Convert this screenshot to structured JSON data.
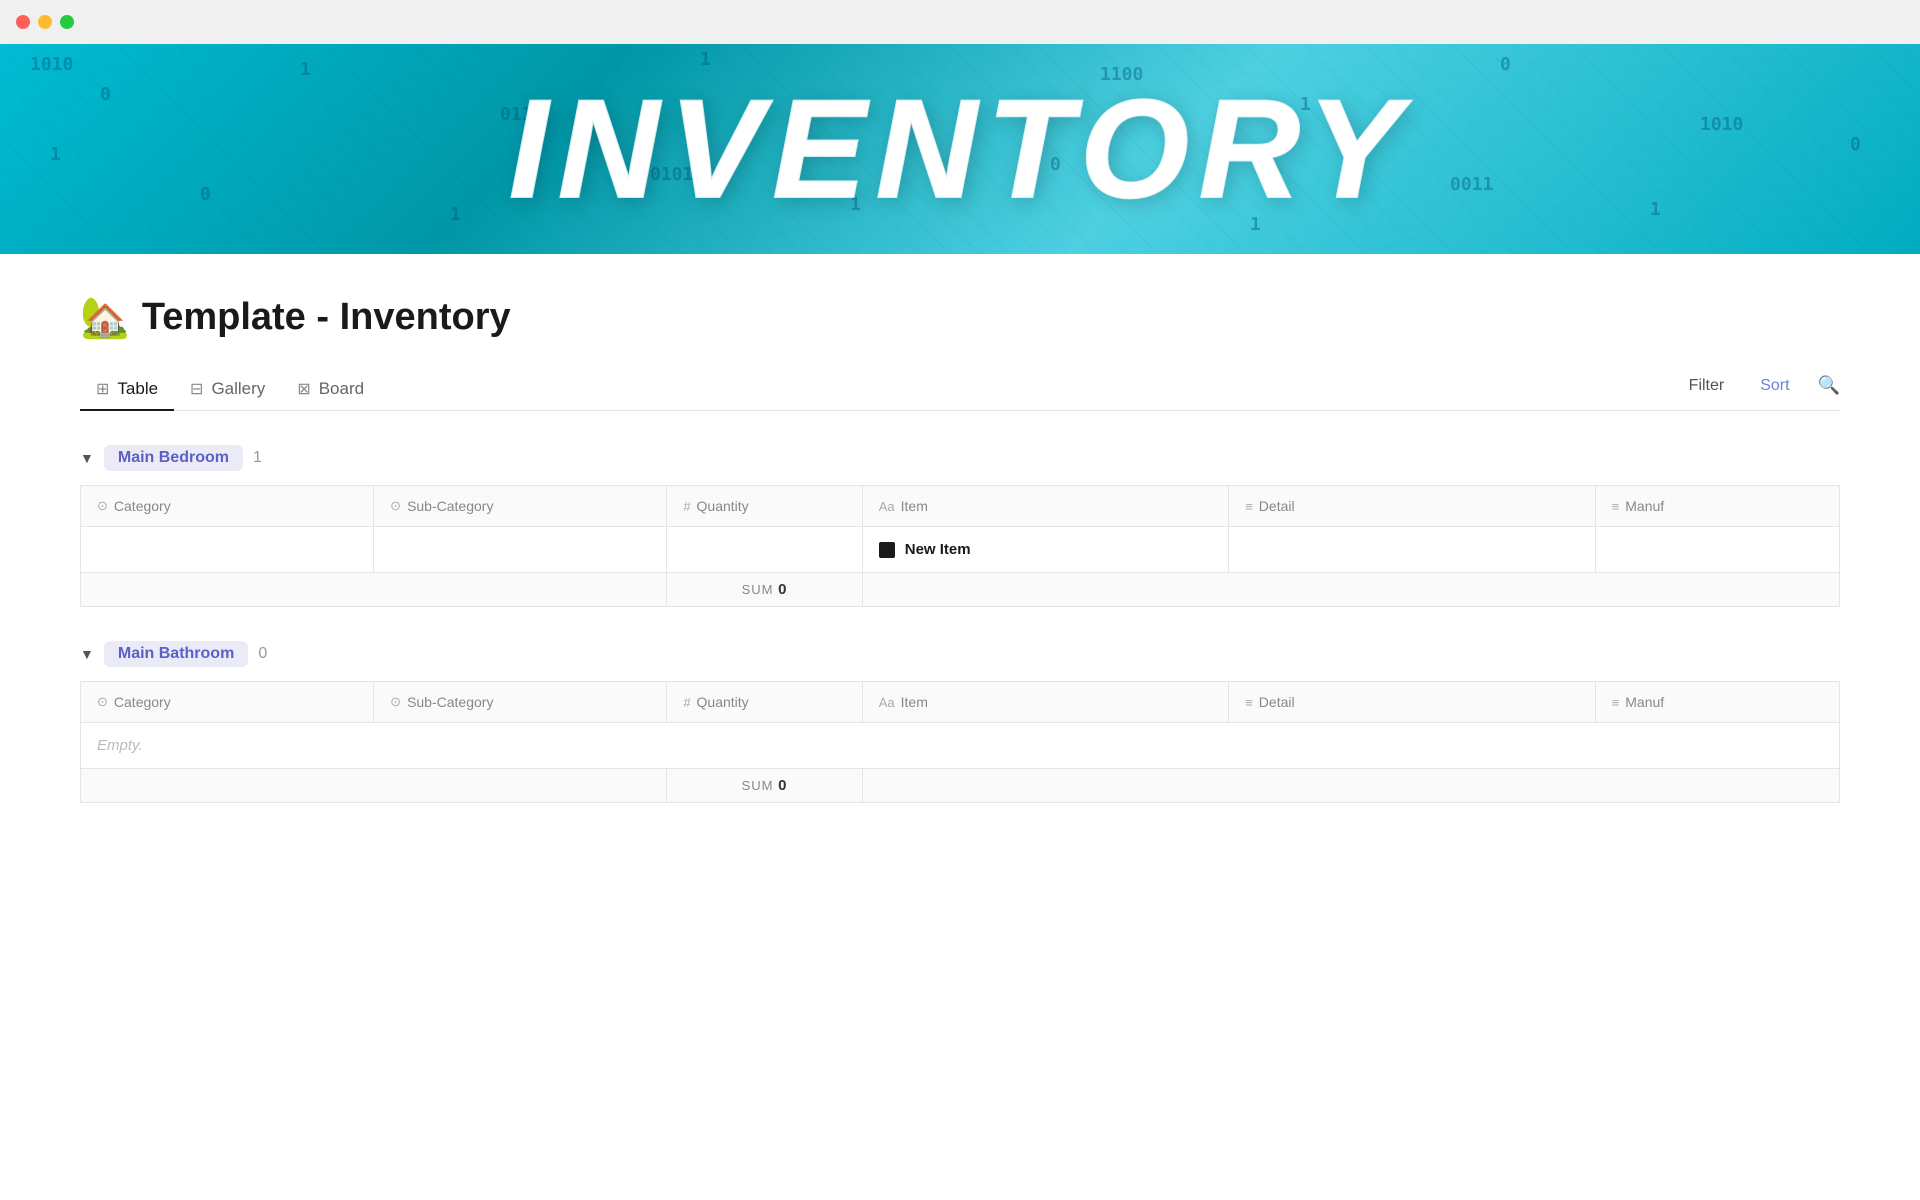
{
  "titlebar": {
    "lights": [
      "red",
      "yellow",
      "green"
    ]
  },
  "hero": {
    "title": "INVENTORY"
  },
  "page": {
    "emoji": "🏡",
    "title": "Template - Inventory"
  },
  "tabs": [
    {
      "id": "table",
      "label": "Table",
      "icon": "⊞",
      "active": true
    },
    {
      "id": "gallery",
      "label": "Gallery",
      "icon": "⊟",
      "active": false
    },
    {
      "id": "board",
      "label": "Board",
      "icon": "⊠",
      "active": false
    }
  ],
  "toolbar": {
    "filter_label": "Filter",
    "sort_label": "Sort",
    "search_label": "🔍"
  },
  "columns": [
    {
      "id": "category",
      "label": "Category",
      "icon": "⊙"
    },
    {
      "id": "subcategory",
      "label": "Sub-Category",
      "icon": "⊙"
    },
    {
      "id": "quantity",
      "label": "Quantity",
      "icon": "#"
    },
    {
      "id": "item",
      "label": "Item",
      "icon": "Aa"
    },
    {
      "id": "detail",
      "label": "Detail",
      "icon": "≡"
    },
    {
      "id": "manuf",
      "label": "Manuf",
      "icon": "≡"
    }
  ],
  "groups": [
    {
      "id": "main-bedroom",
      "label": "Main Bedroom",
      "count": "1",
      "rows": [
        {
          "category": "",
          "subcategory": "",
          "quantity": "",
          "item": "New Item",
          "detail": "",
          "manuf": ""
        }
      ],
      "sum_label": "SUM",
      "sum_value": "0",
      "empty": false
    },
    {
      "id": "main-bathroom",
      "label": "Main Bathroom",
      "count": "0",
      "rows": [],
      "sum_label": "SUM",
      "sum_value": "0",
      "empty": true,
      "empty_label": "Empty."
    }
  ]
}
